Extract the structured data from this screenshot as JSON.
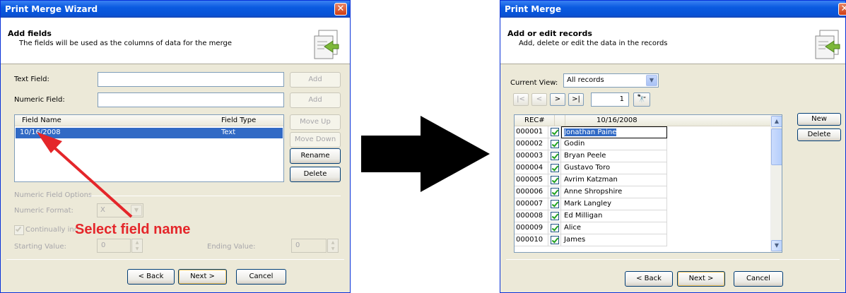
{
  "wizard": {
    "title": "Print Merge Wizard",
    "close_glyph": "✕",
    "header_title": "Add fields",
    "header_subtitle": "The fields will be used as the columns of data for the merge",
    "text_field_label": "Text Field:",
    "numeric_field_label": "Numeric Field:",
    "add_label": "Add",
    "list_columns": [
      "Field Name",
      "Field Type"
    ],
    "fields": [
      {
        "name": "10/16/2008",
        "type": "Text"
      }
    ],
    "move_up_label": "Move Up",
    "move_down_label": "Move Down",
    "rename_label": "Rename",
    "delete_label": "Delete",
    "numeric_options_label": "Numeric Field Options",
    "numeric_format_label": "Numeric Format:",
    "numeric_format_value": "X",
    "continually_label": "Continually inc",
    "starting_value_label": "Starting Value:",
    "starting_value": "0",
    "ending_value_label": "Ending Value:",
    "ending_value": "0",
    "back_label": "< Back",
    "next_label": "Next >",
    "cancel_label": "Cancel"
  },
  "annotation": {
    "text": "Select field name",
    "color": "#E4262A"
  },
  "merge": {
    "title": "Print Merge",
    "header_title": "Add or edit records",
    "header_subtitle": "Add, delete or edit the data in the records",
    "current_view_label": "Current View:",
    "current_view_value": "All records",
    "nav": {
      "first": "|<",
      "prev": "<",
      "next": ">",
      "last": ">|",
      "record_number": "1",
      "find_glyph": "🔭"
    },
    "grid_columns": [
      "REC#",
      "",
      "10/16/2008"
    ],
    "records": [
      {
        "rec": "000001",
        "value": "Jonathan Paine"
      },
      {
        "rec": "000002",
        "value": "Godin"
      },
      {
        "rec": "000003",
        "value": "Bryan Peele"
      },
      {
        "rec": "000004",
        "value": "Gustavo Toro"
      },
      {
        "rec": "000005",
        "value": "Avrim Katzman"
      },
      {
        "rec": "000006",
        "value": "Anne Shropshire"
      },
      {
        "rec": "000007",
        "value": "Mark Langley"
      },
      {
        "rec": "000008",
        "value": "Ed Milligan"
      },
      {
        "rec": "000009",
        "value": "Alice"
      },
      {
        "rec": "000010",
        "value": "James"
      }
    ],
    "new_label": "New",
    "delete_label": "Delete",
    "back_label": "< Back",
    "next_label": "Next >",
    "cancel_label": "Cancel"
  },
  "icons": {
    "arrow_glyph_up": "▲",
    "arrow_glyph_down": "▼"
  }
}
